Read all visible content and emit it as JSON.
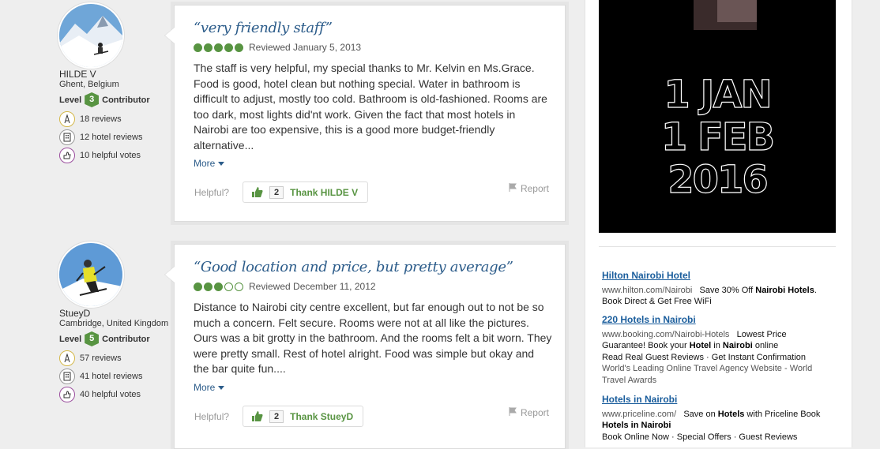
{
  "reviews": [
    {
      "member": {
        "name": "HILDE V",
        "location": "Ghent, Belgium",
        "level_prefix": "Level",
        "level": "3",
        "level_suffix": "Contributor",
        "reviews": "18 reviews",
        "hotel_reviews": "12 hotel reviews",
        "helpful_votes": "10 helpful votes"
      },
      "title": "“very friendly staff”",
      "bubbles": 5,
      "date": "Reviewed January 5, 2013",
      "body": "The staff is very helpful, my special thanks to Mr. Kelvin en Ms.Grace. Food is good, hotel clean but nothing special. Water in bathroom is difficult to adjust, mostly too cold. Bathroom is old-fashioned. Rooms are too dark, most lights did'nt work. Given the fact that most hotels in Nairobi are too expensive, this is a good more budget-friendly alternative...",
      "more": "More",
      "helpful": "Helpful?",
      "thank_count": "2",
      "thank_label": "Thank HILDE V",
      "report": "Report"
    },
    {
      "member": {
        "name": "StueyD",
        "location": "Cambridge, United Kingdom",
        "level_prefix": "Level",
        "level": "5",
        "level_suffix": "Contributor",
        "reviews": "57 reviews",
        "hotel_reviews": "41 hotel reviews",
        "helpful_votes": "40 helpful votes"
      },
      "title": "“Good location and price, but pretty average”",
      "bubbles": 3,
      "date": "Reviewed December 11, 2012",
      "body": "Distance to Nairobi city centre excellent, but far enough out to not be so much a concern. Felt secure. Rooms were not at all like the pictures. Ours was a bit grotty in the bathroom. And the rooms felt a bit worn. They were pretty small. Rest of hotel alright. Food was simple but okay and the bar quite fun....",
      "more": "More",
      "helpful": "Helpful?",
      "thank_count": "2",
      "thank_label": "Thank StueyD",
      "report": "Report"
    }
  ],
  "promo": {
    "line1": "1 JAN",
    "line2": "1 FEB",
    "line3": "2016"
  },
  "ads": [
    {
      "title": "Hilton Nairobi Hotel",
      "url": "www.hilton.com/Nairobi",
      "text_a": "Save 30% Off ",
      "bold_a": "Nairobi Hotels",
      "text_b": ". Book Direct & Get Free WiFi"
    },
    {
      "title": "220 Hotels in Nairobi",
      "url": "www.booking.com/Nairobi-Hotels",
      "text_a": "Lowest Price Guarantee! Book your ",
      "bold_a": "Hotel",
      "text_b": " in ",
      "bold_b": "Nairobi",
      "text_c": " online",
      "line2": "Read Real Guest Reviews · Get Instant Confirmation",
      "line3": "World's Leading Online Travel Agency Website - World Travel Awards"
    },
    {
      "title": "Hotels in Nairobi",
      "url": "www.priceline.com/",
      "text_a": "Save on ",
      "bold_a": "Hotels",
      "text_b": " with Priceline Book ",
      "bold_b": "Hotels in Nairobi",
      "line2": "Book Online Now · Special Offers · Guest Reviews"
    }
  ],
  "colors": {
    "accent_green": "#589442",
    "link_blue": "#2c5c8a",
    "ad_link": "#1a5d9c"
  }
}
